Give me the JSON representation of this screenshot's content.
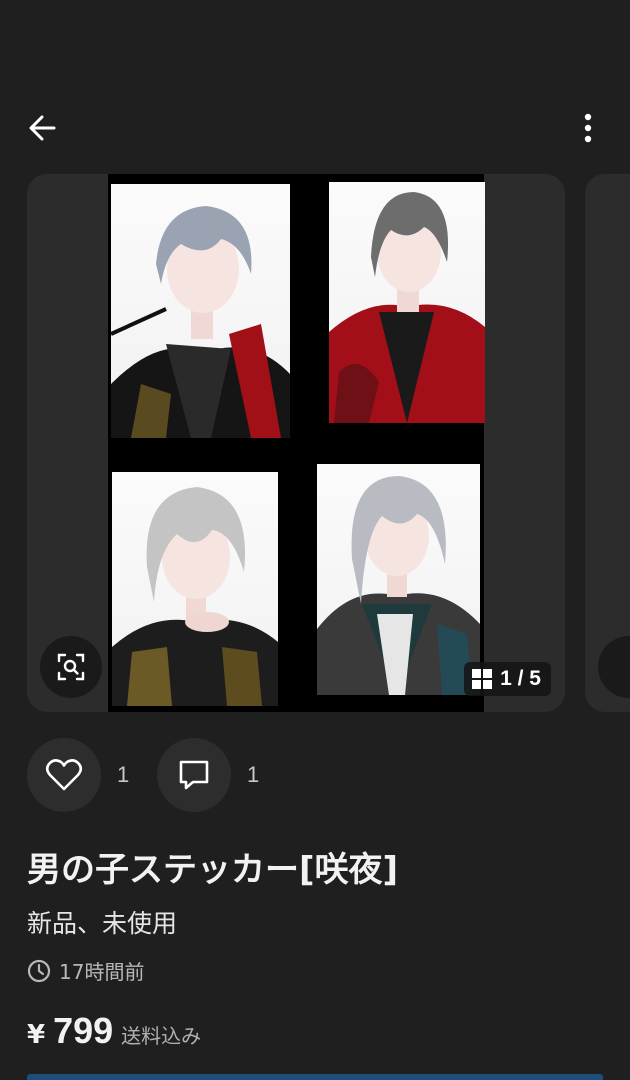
{
  "header": {
    "back_icon": "arrow-left-icon",
    "more_icon": "more-vertical-icon"
  },
  "carousel": {
    "counter": "1 / 5",
    "counter_icon": "grid-icon",
    "lens_icon": "image-search-icon"
  },
  "actions": {
    "like_icon": "heart-icon",
    "like_count": "1",
    "comment_icon": "comment-icon",
    "comment_count": "1"
  },
  "item": {
    "title": "男の子ステッカー[咲夜]",
    "condition": "新品、未使用",
    "time_icon": "clock-icon",
    "time_ago": "17時間前",
    "currency": "¥",
    "price": "799",
    "shipping": "送料込み"
  },
  "colors": {
    "background": "#1f1f1f",
    "card": "#2c2c2c",
    "accent_bar": "#1f4d7a"
  }
}
